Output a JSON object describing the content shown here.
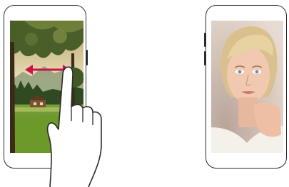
{
  "figure": {
    "left_phone": {
      "screen_image": "landscape-photo",
      "gesture": "swipe-left-right"
    },
    "right_phone": {
      "screen_image": "portrait-photo"
    },
    "icons": {
      "arrow": "double-headed-arrow-icon",
      "hand": "pointing-hand-icon"
    },
    "colors": {
      "arrow": "#c8154a",
      "outline": "#2b2b2b"
    }
  }
}
